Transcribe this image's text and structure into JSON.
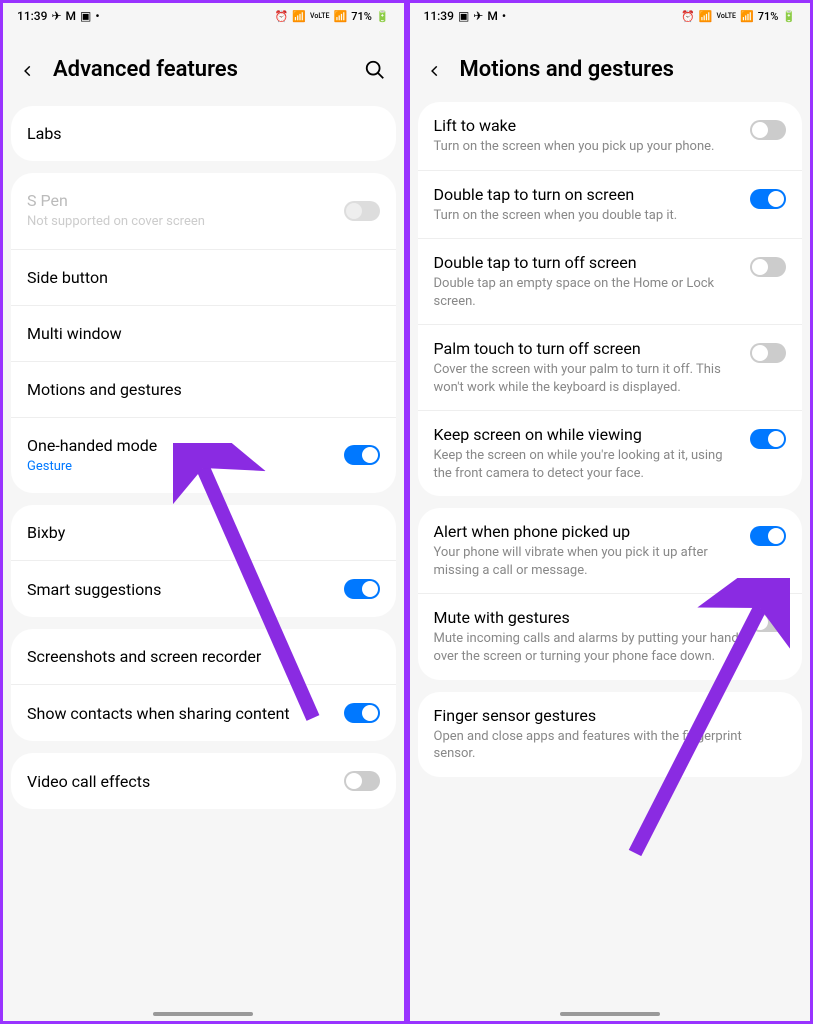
{
  "status": {
    "time": "11:39",
    "battery": "71%",
    "volte": "VoLTE"
  },
  "left": {
    "title": "Advanced features",
    "groups": [
      [
        {
          "title": "Labs"
        }
      ],
      [
        {
          "title": "S Pen",
          "sub": "Not supported on cover screen",
          "disabled": true,
          "toggle": "off-disabled"
        },
        {
          "title": "Side button"
        },
        {
          "title": "Multi window"
        },
        {
          "title": "Motions and gestures"
        },
        {
          "title": "One-handed mode",
          "sub": "Gesture",
          "accent": true,
          "toggle": "on"
        }
      ],
      [
        {
          "title": "Bixby"
        },
        {
          "title": "Smart suggestions",
          "toggle": "on"
        }
      ],
      [
        {
          "title": "Screenshots and screen recorder"
        },
        {
          "title": "Show contacts when sharing content",
          "toggle": "on"
        }
      ],
      [
        {
          "title": "Video call effects",
          "toggle": "off"
        }
      ]
    ]
  },
  "right": {
    "title": "Motions and gestures",
    "groups": [
      [
        {
          "title": "Lift to wake",
          "sub": "Turn on the screen when you pick up your phone.",
          "toggle": "off"
        },
        {
          "title": "Double tap to turn on screen",
          "sub": "Turn on the screen when you double tap it.",
          "toggle": "on"
        },
        {
          "title": "Double tap to turn off screen",
          "sub": "Double tap an empty space on the Home or Lock screen.",
          "toggle": "off"
        },
        {
          "title": "Palm touch to turn off screen",
          "sub": "Cover the screen with your palm to turn it off. This won't work while the keyboard is displayed.",
          "toggle": "off"
        },
        {
          "title": "Keep screen on while viewing",
          "sub": "Keep the screen on while you're looking at it, using the front camera to detect your face.",
          "toggle": "on"
        }
      ],
      [
        {
          "title": "Alert when phone picked up",
          "sub": "Your phone will vibrate when you pick it up after missing a call or message.",
          "toggle": "on"
        },
        {
          "title": "Mute with gestures",
          "sub": "Mute incoming calls and alarms by putting your hand over the screen or turning your phone face down.",
          "toggle": "off"
        }
      ],
      [
        {
          "title": "Finger sensor gestures",
          "sub": "Open and close apps and features with the fingerprint sensor."
        }
      ]
    ]
  }
}
